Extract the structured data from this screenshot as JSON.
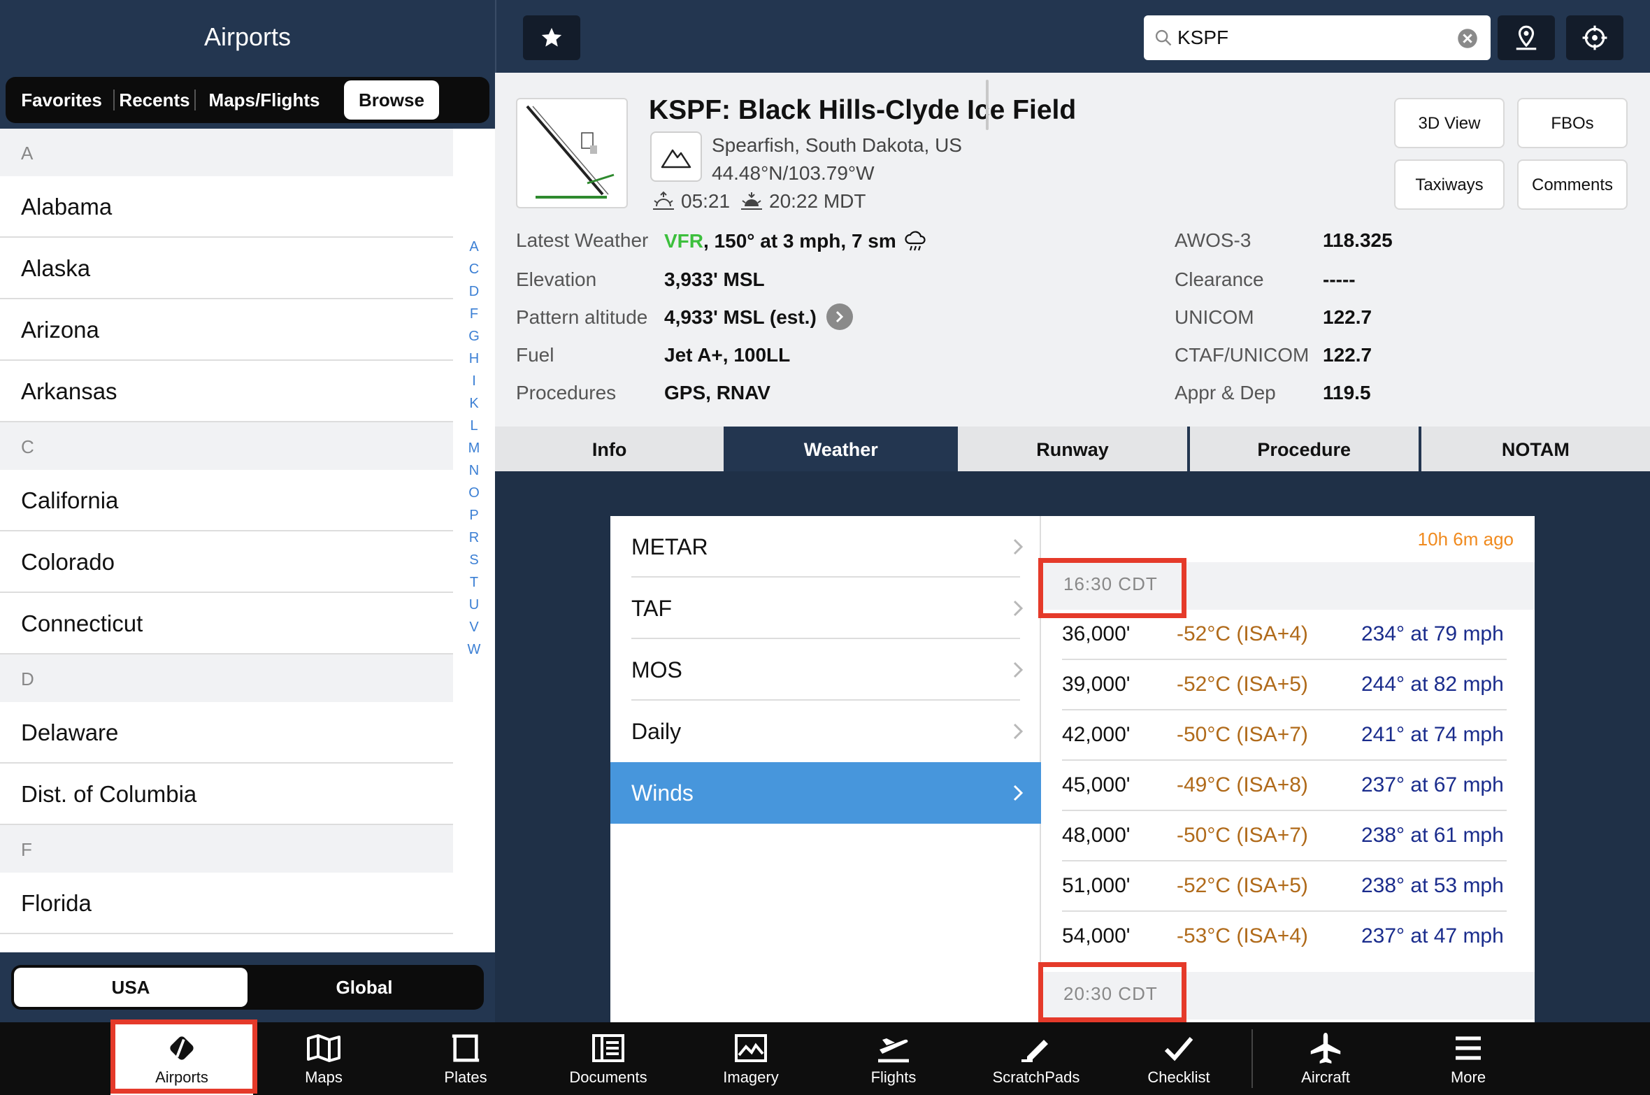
{
  "sidebar": {
    "title": "Airports",
    "segments": [
      "Favorites",
      "Recents",
      "Maps/Flights",
      "Browse"
    ],
    "active_segment": "Browse",
    "sections": [
      {
        "letter": "A",
        "states": [
          "Alabama",
          "Alaska",
          "Arizona",
          "Arkansas"
        ]
      },
      {
        "letter": "C",
        "states": [
          "California",
          "Colorado",
          "Connecticut"
        ]
      },
      {
        "letter": "D",
        "states": [
          "Delaware",
          "Dist. of Columbia"
        ]
      },
      {
        "letter": "F",
        "states": [
          "Florida"
        ]
      }
    ],
    "index_letters": [
      "A",
      "C",
      "D",
      "F",
      "G",
      "H",
      "I",
      "K",
      "L",
      "M",
      "N",
      "O",
      "P",
      "R",
      "S",
      "T",
      "U",
      "V",
      "W"
    ],
    "region_options": [
      "USA",
      "Global"
    ],
    "active_region": "USA",
    "index_color": "#3b7fd4"
  },
  "topbar": {
    "search_value": "KSPF",
    "icons": [
      "star-icon",
      "map-pin-icon",
      "crosshair-icon",
      "search-icon",
      "clear-icon"
    ]
  },
  "airport": {
    "title": "KSPF: Black Hills-Clyde Ice Field",
    "location": "Spearfish, South Dakota, US",
    "coords": "44.48°N/103.79°W",
    "sunrise": "05:21",
    "sunset": "20:22 MDT",
    "buttons": {
      "view3d": "3D View",
      "fbos": "FBOs",
      "taxiways": "Taxiways",
      "comments": "Comments"
    },
    "info": {
      "weather_label": "Latest Weather",
      "weather_cat": "VFR",
      "weather_rest": ", 150° at 3 mph, 7 sm",
      "elevation_label": "Elevation",
      "elevation": "3,933' MSL",
      "pattern_label": "Pattern altitude",
      "pattern": "4,933' MSL (est.)",
      "fuel_label": "Fuel",
      "fuel": "Jet A+, 100LL",
      "procedures_label": "Procedures",
      "procedures": "GPS, RNAV"
    },
    "freqs": [
      {
        "label": "AWOS-3",
        "value": "118.325"
      },
      {
        "label": "Clearance",
        "value": "-----"
      },
      {
        "label": "UNICOM",
        "value": "122.7"
      },
      {
        "label": "CTAF/UNICOM",
        "value": "122.7"
      },
      {
        "label": "Appr & Dep",
        "value": "119.5"
      }
    ],
    "colors": {
      "vfr": "#3cbf3c"
    }
  },
  "tabs": [
    "Info",
    "Weather",
    "Runway",
    "Procedure",
    "NOTAM"
  ],
  "active_tab": "Weather",
  "weather": {
    "menu": [
      "METAR",
      "TAF",
      "MOS",
      "Daily",
      "Winds"
    ],
    "active_menu": "Winds",
    "ago": "10h 6m ago",
    "time1": "16:30 CDT",
    "time2": "20:30 CDT",
    "rows": [
      {
        "alt": "36,000'",
        "temp": "-52°C (ISA+4)",
        "wind": "234° at 79 mph"
      },
      {
        "alt": "39,000'",
        "temp": "-52°C (ISA+5)",
        "wind": "244° at 82 mph"
      },
      {
        "alt": "42,000'",
        "temp": "-50°C (ISA+7)",
        "wind": "241° at 74 mph"
      },
      {
        "alt": "45,000'",
        "temp": "-49°C (ISA+8)",
        "wind": "237° at 67 mph"
      },
      {
        "alt": "48,000'",
        "temp": "-50°C (ISA+7)",
        "wind": "238° at 61 mph"
      },
      {
        "alt": "51,000'",
        "temp": "-52°C (ISA+5)",
        "wind": "238° at 53 mph"
      },
      {
        "alt": "54,000'",
        "temp": "-53°C (ISA+4)",
        "wind": "237° at 47 mph"
      }
    ],
    "colors": {
      "temp": "#b06a1a",
      "wind": "#1a2c8c",
      "ago": "#f08a1e",
      "menu_active": "#4796dc"
    }
  },
  "tabbar": {
    "items": [
      {
        "label": "Airports",
        "icon": "airport-icon"
      },
      {
        "label": "Maps",
        "icon": "map-icon"
      },
      {
        "label": "Plates",
        "icon": "plates-icon"
      },
      {
        "label": "Documents",
        "icon": "documents-icon"
      },
      {
        "label": "Imagery",
        "icon": "imagery-icon"
      },
      {
        "label": "Flights",
        "icon": "flights-icon"
      },
      {
        "label": "ScratchPads",
        "icon": "scratchpad-icon"
      },
      {
        "label": "Checklist",
        "icon": "checklist-icon"
      },
      {
        "label": "Aircraft",
        "icon": "aircraft-icon"
      },
      {
        "label": "More",
        "icon": "more-icon"
      }
    ],
    "active": "Airports"
  },
  "highlight_color": "#e53a2a"
}
